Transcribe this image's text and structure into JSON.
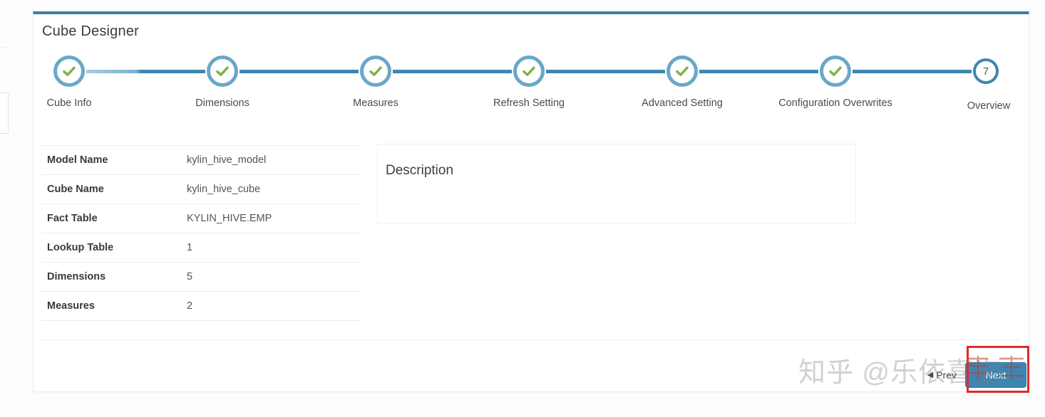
{
  "card": {
    "title": "Cube Designer",
    "accent_color": "#3d7f9a"
  },
  "stepper": {
    "steps": [
      {
        "label": "Cube Info",
        "state": "done",
        "marker": "check"
      },
      {
        "label": "Dimensions",
        "state": "done",
        "marker": "check"
      },
      {
        "label": "Measures",
        "state": "done",
        "marker": "check"
      },
      {
        "label": "Refresh Setting",
        "state": "done",
        "marker": "check"
      },
      {
        "label": "Advanced Setting",
        "state": "done",
        "marker": "check"
      },
      {
        "label": "Configuration Overwrites",
        "state": "done",
        "marker": "check"
      },
      {
        "label": "Overview",
        "state": "current",
        "marker": "7"
      }
    ],
    "check_color": "#7cb342",
    "ring_color": "#6aa7c8",
    "line_color": "#3f86b0"
  },
  "info_table": {
    "rows": [
      {
        "key": "Model Name",
        "value": "kylin_hive_model"
      },
      {
        "key": "Cube Name",
        "value": "kylin_hive_cube"
      },
      {
        "key": "Fact Table",
        "value": "KYLIN_HIVE.EMP"
      },
      {
        "key": "Lookup Table",
        "value": "1"
      },
      {
        "key": "Dimensions",
        "value": "5"
      },
      {
        "key": "Measures",
        "value": "2"
      }
    ]
  },
  "description_panel": {
    "title": "Description",
    "body": ""
  },
  "footer": {
    "prev_label": "Prev",
    "prev_icon": "chevron-left-icon",
    "next_label": "Next",
    "next_color": "#3c86b4"
  },
  "annotation": {
    "highlight_color": "#e02b2b"
  },
  "watermark": {
    "text": "知乎 @乐依喜盗"
  }
}
